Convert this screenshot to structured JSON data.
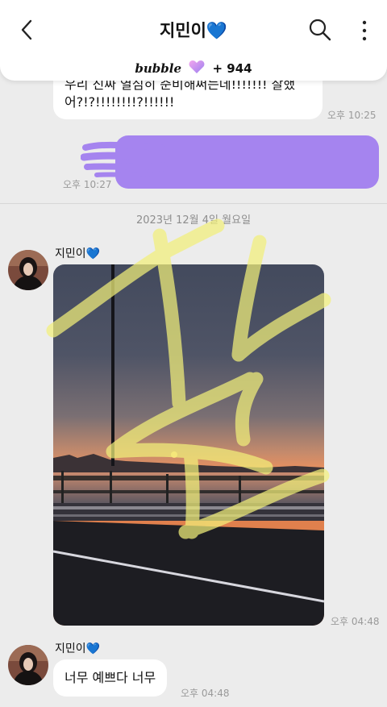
{
  "header": {
    "title": "지민이💙",
    "bubble_brand": "bubble",
    "bubble_count": "+ 944",
    "icons": [
      "chevron-left-icon",
      "search-icon",
      "more-vertical-icon"
    ]
  },
  "messages": {
    "top_text": "우리 진짜 열심히 준비해써는데!!!!!!! 잘했어?!?!!!!!!!!?!!!!!!",
    "top_time": "오후 10:25",
    "purple_time": "오후 10:27",
    "date_separator": "2023년 12월 4일 월요일",
    "sender_name": "지민이💙",
    "photo_time": "오후 04:48",
    "sender_name_2": "지민이💙",
    "last_text": "너무 예쁘다 너무",
    "last_time": "오후 04:48"
  },
  "colors": {
    "accent_purple": "#a584ef",
    "highlight_yellow": "#f2f07a",
    "background": "#ececec"
  }
}
